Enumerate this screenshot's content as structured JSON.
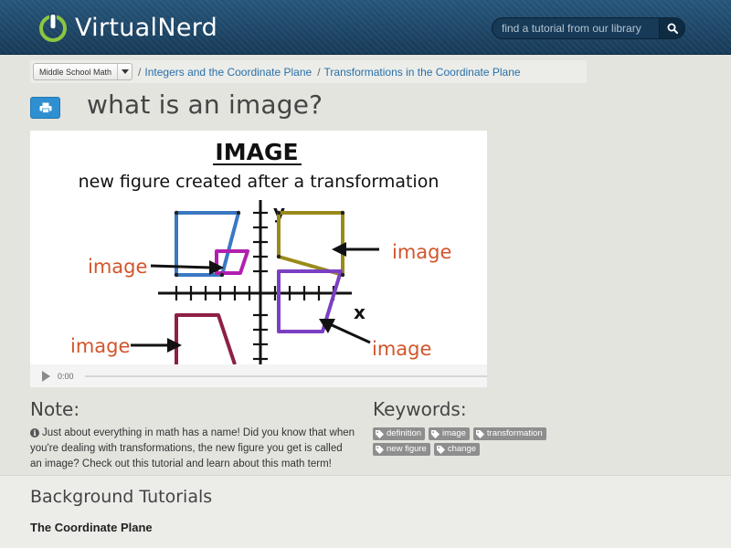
{
  "header": {
    "logo_virtual": "Virtual",
    "logo_nerd": "Nerd",
    "search_placeholder": "find a tutorial from our library"
  },
  "breadcrumb": {
    "course": "Middle School Math",
    "items": [
      "Integers and the Coordinate Plane",
      "Transformations in the Coordinate Plane"
    ]
  },
  "page": {
    "title": "what is an image?"
  },
  "video": {
    "heading": "IMAGE",
    "subtitle": "new figure created after a transformation",
    "labels": [
      "image",
      "image",
      "image",
      "image"
    ],
    "axis_y": "y",
    "axis_x": "x",
    "time": "0:00",
    "progress": 0
  },
  "note": {
    "heading": "Note:",
    "text": "Just about everything in math has a name! Did you know that when you're dealing with transformations, the new figure you get is called an image? Check out this tutorial and learn about this math term!"
  },
  "keywords": {
    "heading": "Keywords:",
    "tags": [
      "definition",
      "image",
      "transformation",
      "new figure",
      "change"
    ]
  },
  "background": {
    "heading": "Background Tutorials",
    "first_link": "The Coordinate Plane"
  },
  "colors": {
    "header_bg": "#1f4a6b",
    "link": "#2a6fa8",
    "print_button": "#2e8fd1",
    "tag_bg": "#8e8e8e",
    "figure_blue": "#3a78c2",
    "figure_magenta": "#b21fb0",
    "figure_olive": "#9a8a1a",
    "figure_purple": "#7b3fc4",
    "figure_maroon": "#8e1f45",
    "label_orange": "#d2552b"
  },
  "icons": {
    "logo": "power-icon",
    "search": "search-icon",
    "print": "print-icon",
    "caret": "caret-down-icon",
    "info": "info-icon",
    "tag": "tag-icon",
    "play": "play-icon"
  }
}
